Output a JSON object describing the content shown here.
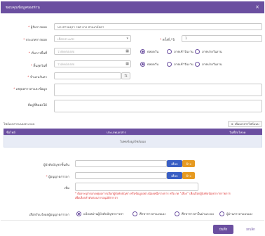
{
  "modal": {
    "title": "ขอบคุณข้อมูลของท่าน",
    "close_symbol": "×"
  },
  "form": {
    "recipient_label": "ผู้รับการยอด",
    "recipient_value": "นางสาวมยุรา รยศ ยวง สวนเกษ์ลดา",
    "type_label": "ประเภทการยอด",
    "type_value": "เลือกประเภท",
    "count_label": "ครั้งที่ / ปี",
    "count_value": "1",
    "start_label": "เริ่มการยื่นที่",
    "start_placeholder": "วว/ดด/ปปปป",
    "end_label": "สิ้นสุดวันที่",
    "end_placeholder": "วว/ดด/ปปปป",
    "time_options": [
      "ตลอดวัน",
      "ภาคเช้าวันงาน",
      "ภาคบ่ายวันงาน"
    ],
    "days_label": "จำนวนวันลา",
    "reason_label": "เหตุผลการลาและข้อมูล",
    "contact_label": "ที่อยู่ที่ติดต่อได้"
  },
  "attachments": {
    "section_label": "ไฟล์เอกสารแนบประกอบ",
    "add_button": "เพิ่มเอกสารไฟล์แนบ",
    "columns": [
      "ชื่อไฟล์",
      "ประเภทเอกสาร",
      "วันที่อัปโหลด"
    ],
    "empty_text": "ไม่พบข้อมูลไฟล์แนบ"
  },
  "approval": {
    "approver_label": "ผู้บังคับบัญชาชั้นต้น",
    "manager_label": "ผู้อนุญาตการลา",
    "choose_button": "เลือก",
    "clear_button": "ล้าง",
    "reason_label": "เพิ่ม",
    "note": "* ต้องระบุ/กรอกเหตุผลการเลือกผู้บังคับบัญชา หรือข้อมูลอย่างน้อยหนึ่งรายการ หรือ กด \"เลือก\" เพื่อเลือกผู้บังคับบัญชาจากรายการเพื่อเลือกลำดับก่อนการอนุมัติการลา",
    "notify_label": "เลือกรับแจ้งผลผู้อนุญาตการลา",
    "notify_options": [
      "แจ้งผลผ่านผู้บังคับบัญชาการลา",
      "ศึกษาการลาแบบเอง",
      "ศึกษาการลาในผ่านระบบ",
      "ผู้ผ่านการลาแบบเอง"
    ]
  },
  "footer": {
    "save": "บันทึก",
    "cancel": "ยกเลิก"
  },
  "colors": {
    "primary": "#6b4fa0",
    "blue": "#3a5fc4",
    "orange": "#e69a21",
    "error": "#dd3333"
  }
}
